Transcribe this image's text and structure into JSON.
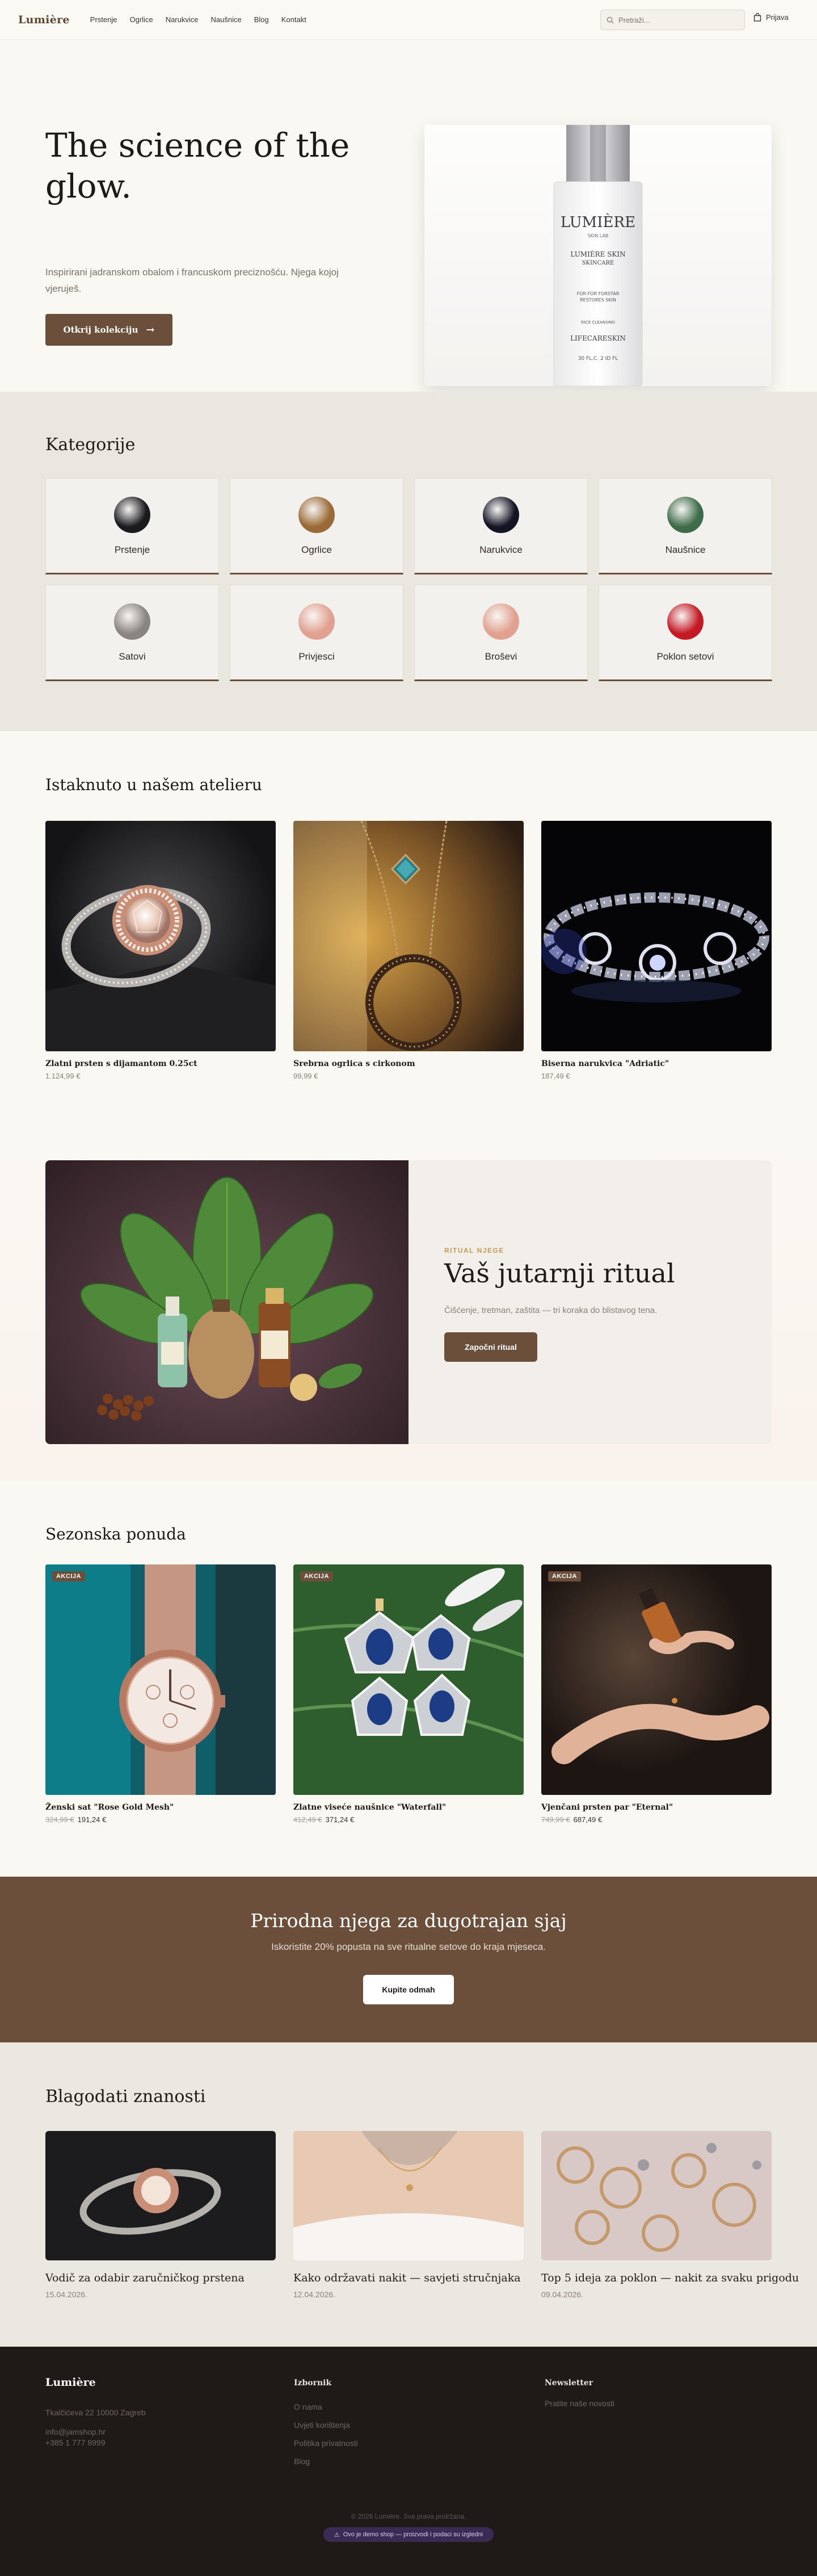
{
  "header": {
    "logo": "Lumière",
    "nav": [
      "Prstenje",
      "Ogrlice",
      "Narukvice",
      "Naušnice",
      "Blog",
      "Kontakt"
    ],
    "search_placeholder": "Pretraži...",
    "cart_label": "Prijava"
  },
  "hero": {
    "title": "The science of the glow.",
    "subtitle": "Inspirirani jadranskom obalom i francuskom preciznošću. Njega kojoj vjeruješ.",
    "button": "Otkrij kolekciju",
    "bottle": {
      "brand": "LUMIÈRE",
      "brand_sub": "SKIN LAB",
      "line1": "LUMIÈRE SKIN",
      "line2": "SKINCARE",
      "line3": "FOR FOR FORSTAR",
      "line4": "RESTORES SKIN",
      "line5": "FACE CLEANSING",
      "line6": "LIFECARESKIN",
      "size": "30 FL.C. 2 ID FL"
    }
  },
  "categories": {
    "title": "Kategorije",
    "items": [
      {
        "label": "Prstenje",
        "color": "#1b1b1f"
      },
      {
        "label": "Ogrlice",
        "color": "#9a6a36"
      },
      {
        "label": "Narukvice",
        "color": "#141425"
      },
      {
        "label": "Naušnice",
        "color": "#3e6b48"
      },
      {
        "label": "Satovi",
        "color": "#8a8580"
      },
      {
        "label": "Privjesci",
        "color": "#e1a190"
      },
      {
        "label": "Broševi",
        "color": "#e1a190"
      },
      {
        "label": "Poklon setovi",
        "color": "#c41a25"
      }
    ]
  },
  "featured": {
    "title": "Istaknuto u našem atelieru",
    "products": [
      {
        "name": "Zlatni prsten s dijamantom 0.25ct",
        "price": "1.124,99 €"
      },
      {
        "name": "Srebrna ogrlica s cirkonom",
        "price": "99,99 €"
      },
      {
        "name": "Biserna narukvica \"Adriatic\"",
        "price": "187,49 €"
      }
    ]
  },
  "ritual": {
    "kicker": "RITUAL NJEGE",
    "title": "Vaš jutarnji ritual",
    "text": "Čišćenje, tretman, zaštita — tri koraka do blistavog tena.",
    "button": "Započni ritual"
  },
  "seasonal": {
    "title": "Sezonska ponuda",
    "badge": "AKCIJA",
    "products": [
      {
        "name": "Ženski sat \"Rose Gold Mesh\"",
        "old_price": "324,99 €",
        "price": "191,24 €"
      },
      {
        "name": "Zlatne viseće naušnice \"Waterfall\"",
        "old_price": "412,49 €",
        "price": "371,24 €"
      },
      {
        "name": "Vjenčani prsten par \"Eternal\"",
        "old_price": "749,99 €",
        "price": "687,49 €"
      }
    ]
  },
  "promo": {
    "title": "Prirodna njega za dugotrajan sjaj",
    "text": "Iskoristite 20% popusta na sve ritualne setove do kraja mjeseca.",
    "button": "Kupite odmah"
  },
  "blog": {
    "title": "Blagodati znanosti",
    "posts": [
      {
        "title": "Vodič za odabir zaručničkog prstena",
        "date": "15.04.2026."
      },
      {
        "title": "Kako održavati nakit — savjeti stručnjaka",
        "date": "12.04.2026."
      },
      {
        "title": "Top 5 ideja za poklon — nakit za svaku prigodu",
        "date": "09.04.2026."
      }
    ]
  },
  "footer": {
    "logo": "Lumière",
    "address": "Tkalčićeva 22 10000 Zagreb",
    "email": "info@jamshop.hr",
    "phone": "+385 1 777 8999",
    "col2_title": "Izbornik",
    "col2_links": [
      "O nama",
      "Uvjeti korištenja",
      "Politika privatnosti",
      "Blog"
    ],
    "col3_title": "Newsletter",
    "col3_text": "Pratite naše novosti",
    "copyright": "© 2026 Lumière. Sva prava pridržana.",
    "demo_note": "Ovo je demo shop — proizvodi i podaci su izgledni"
  }
}
